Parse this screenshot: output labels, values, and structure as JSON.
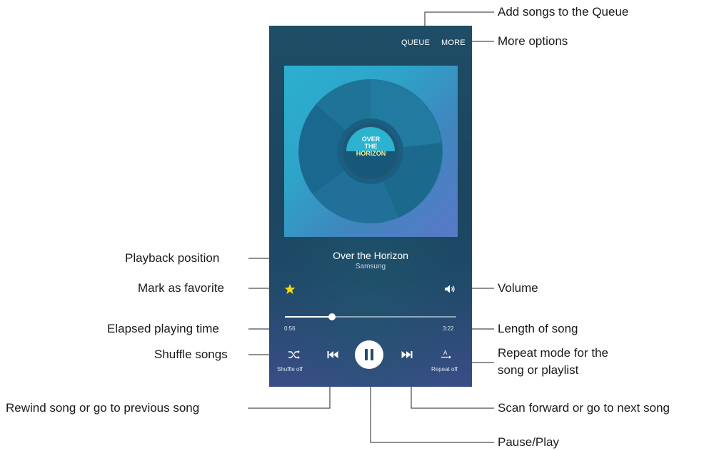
{
  "player": {
    "top_actions": {
      "queue": "QUEUE",
      "more": "MORE"
    },
    "album": {
      "line1": "OVER",
      "line2": "THE",
      "line3": "HORIZON"
    },
    "song": {
      "title": "Over the Horizon",
      "artist": "Samsung"
    },
    "progress": {
      "elapsed": "0:56",
      "total": "3:22",
      "fraction": 0.277
    },
    "controls": {
      "shuffle_label": "Shuffle off",
      "repeat_label": "Repeat off",
      "repeat_glyph": "A"
    },
    "icons": {
      "favorite": "star-icon",
      "volume": "volume-icon",
      "shuffle": "shuffle-icon",
      "previous": "previous-icon",
      "play_pause": "pause-icon",
      "next": "next-icon",
      "repeat": "repeat-icon"
    },
    "colors": {
      "favorite_star": "#f5d90a",
      "accent": "#ffffff"
    }
  },
  "callouts": {
    "add_songs_queue": "Add songs to the Queue",
    "more_options": "More options",
    "playback_position": "Playback position",
    "mark_favorite": "Mark as favorite",
    "volume": "Volume",
    "elapsed_time": "Elapsed playing time",
    "length_of_song": "Length of song",
    "shuffle_songs": "Shuffle songs",
    "repeat_mode_line1": "Repeat mode for the",
    "repeat_mode_line2": "song or playlist",
    "rewind": "Rewind song or go to previous song",
    "scan_forward": "Scan forward or go to next song",
    "pause_play": "Pause/Play"
  }
}
